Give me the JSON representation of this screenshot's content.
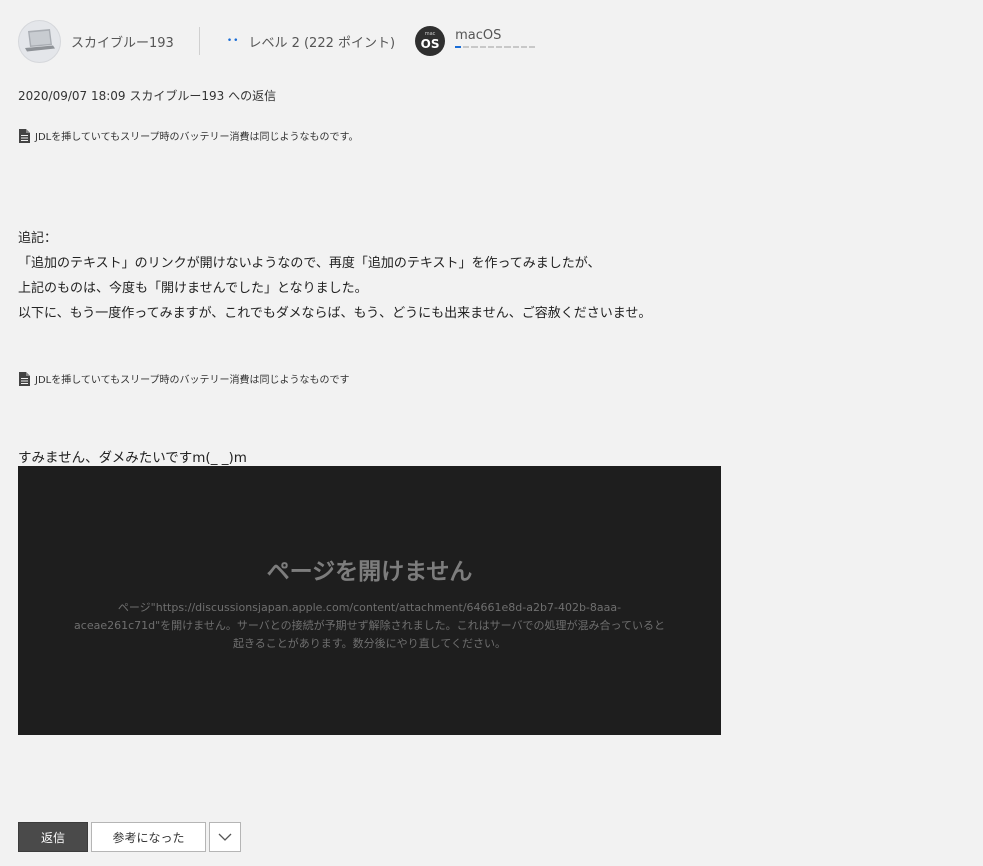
{
  "header": {
    "username": "スカイブルー193",
    "level_dots": "••",
    "level_text": "レベル 2  (222 ポイント)",
    "os_badge_small": "mac",
    "os_badge_big": "OS",
    "os_name": "macOS",
    "os_progress_fraction": 0.1
  },
  "post": {
    "reply_meta": "2020/09/07 18:09 スカイブルー193 への返信",
    "attachment_1": "JDLを挿していてもスリープ時のバッテリー消費は同じようなものです。",
    "body_lines": [
      "追記：",
      "「追加のテキスト」のリンクが開けないようなので、再度「追加のテキスト」を作ってみましたが、",
      "上記のものは、今度も「開けませんでした」となりました。",
      "以下に、もう一度作ってみますが、これでもダメならば、もう、どうにも出来ません、ご容赦くださいませ。"
    ],
    "attachment_2": "JDLを挿していてもスリープ時のバッテリー消費は同じようなものです",
    "sorry_text": "すみません、ダメみたいですm(_ _)m"
  },
  "error_page": {
    "title": "ページを開けません",
    "message": "ページ\"https://discussionsjapan.apple.com/content/attachment/64661e8d-a2b7-402b-8aaa-aceae261c71d\"を開けません。サーバとの接続が予期せず解除されました。これはサーバでの処理が混み合っていると起きることがあります。数分後にやり直してください。"
  },
  "footer": {
    "reply_label": "返信",
    "helpful_label": "参考になった"
  },
  "colors": {
    "accent": "#1a6dd6",
    "page_bg": "#f2f2f2",
    "error_bg": "#1e1e1e"
  }
}
